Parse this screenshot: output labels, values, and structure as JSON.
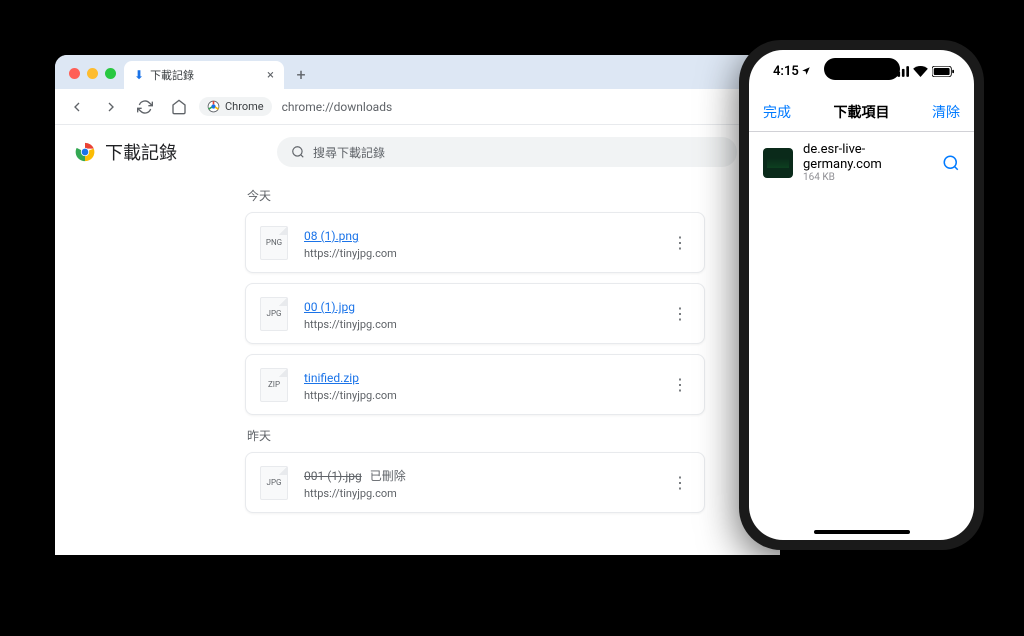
{
  "desktop": {
    "tab_title": "下載記錄",
    "chrome_pill_label": "Chrome",
    "url": "chrome://downloads",
    "page_title": "下載記錄",
    "search_placeholder": "搜尋下載記錄",
    "sections": [
      {
        "label": "今天",
        "items": [
          {
            "name": "08 (1).png",
            "source": "https://tinyjpg.com",
            "deleted": false
          },
          {
            "name": "00 (1).jpg",
            "source": "https://tinyjpg.com",
            "deleted": false
          },
          {
            "name": "tinified.zip",
            "source": "https://tinyjpg.com",
            "deleted": false
          }
        ]
      },
      {
        "label": "昨天",
        "items": [
          {
            "name": "001 (1).jpg",
            "source": "https://tinyjpg.com",
            "deleted": true,
            "deleted_label": "已刪除"
          }
        ]
      }
    ]
  },
  "phone": {
    "time": "4:15",
    "done_label": "完成",
    "title": "下載項目",
    "clear_label": "清除",
    "item": {
      "name": "de.esr-live-germany.com",
      "size": "164 KB"
    }
  }
}
